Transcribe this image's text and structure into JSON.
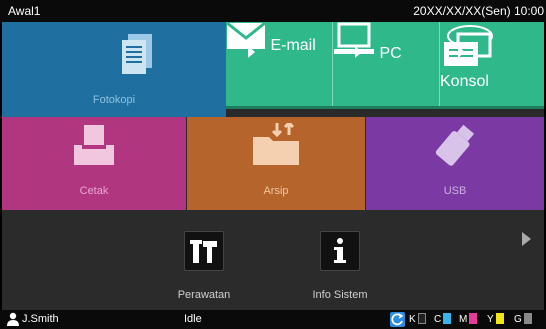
{
  "header": {
    "title": "Awal1",
    "datetime": "20XX/XX/XX(Sen) 10:00"
  },
  "tiles": {
    "fotokopi": {
      "label": "Fotokopi",
      "icon": "document-stack-icon"
    },
    "email": {
      "label": "E-mail",
      "icon": "envelope-icon"
    },
    "pc": {
      "label": "PC",
      "icon": "laptop-icon"
    },
    "konsol": {
      "label": "Konsol",
      "icon": "console-icon"
    },
    "cetak": {
      "label": "Cetak",
      "icon": "printer-icon"
    },
    "arsip": {
      "label": "Arsip",
      "icon": "folder-transfer-icon"
    },
    "usb": {
      "label": "USB",
      "icon": "usb-drive-icon"
    },
    "perawatan": {
      "label": "Perawatan",
      "icon": "tools-icon"
    },
    "info_sistem": {
      "label": "Info Sistem",
      "icon": "info-icon"
    }
  },
  "statusbar": {
    "user": "J.Smith",
    "status": "Idle",
    "inks": [
      {
        "letter": "K",
        "color": "#222222"
      },
      {
        "letter": "C",
        "color": "#35b6e8"
      },
      {
        "letter": "M",
        "color": "#e63b9a"
      },
      {
        "letter": "Y",
        "color": "#f2e51a"
      },
      {
        "letter": "G",
        "color": "#8a8a8a"
      }
    ]
  },
  "colors": {
    "fotokopi": "#1f6fa0",
    "send": "#2fb98a",
    "cetak": "#b0367f",
    "arsip": "#b5642c",
    "usb": "#7b3aa3"
  }
}
